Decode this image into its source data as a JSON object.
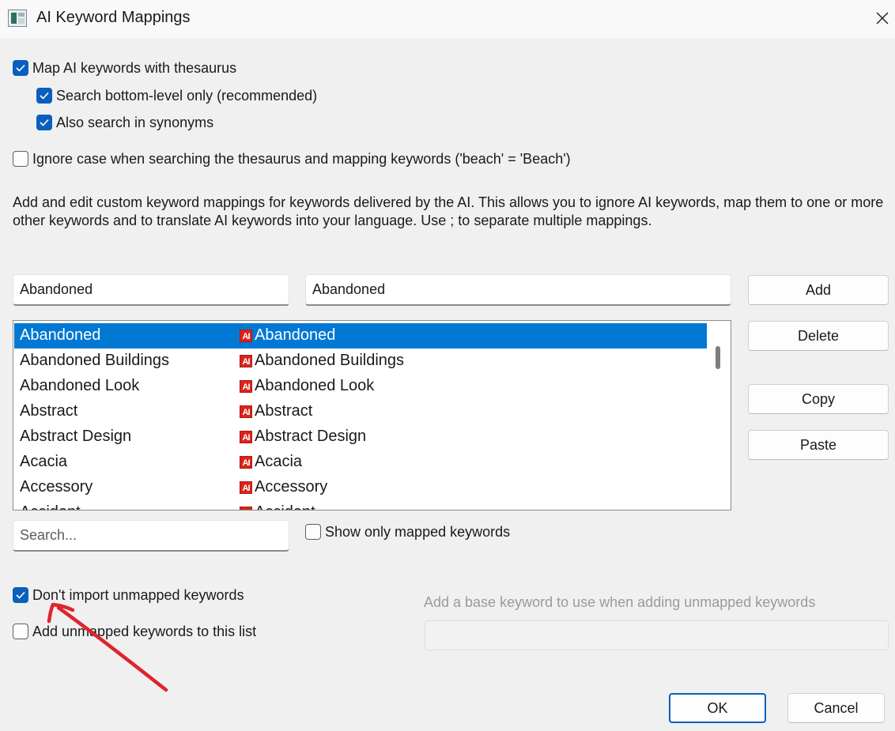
{
  "window": {
    "title": "AI Keyword Mappings",
    "icon": "app-icon",
    "close_icon": "close-icon"
  },
  "options": {
    "map_with_thesaurus": {
      "label": "Map AI keywords with thesaurus",
      "checked": true
    },
    "search_bottom_level": {
      "label": "Search bottom-level only (recommended)",
      "checked": true
    },
    "search_synonyms": {
      "label": "Also search in synonyms",
      "checked": true
    },
    "ignore_case": {
      "label": "Ignore case when searching the thesaurus and mapping keywords ('beach' = 'Beach')",
      "checked": false
    }
  },
  "description": "Add and edit custom keyword mappings for keywords delivered by the AI. This allows you to ignore AI keywords, map them to one or more other keywords and to translate AI keywords into your language. Use ; to separate multiple mappings.",
  "editor": {
    "ai_keyword_value": "Abandoned",
    "mapping_value": "Abandoned"
  },
  "buttons": {
    "add": "Add",
    "delete": "Delete",
    "copy": "Copy",
    "paste": "Paste",
    "ok": "OK",
    "cancel": "Cancel"
  },
  "mappings": [
    {
      "ai_keyword": "Abandoned",
      "mapped_to": "Abandoned",
      "selected": true
    },
    {
      "ai_keyword": "Abandoned Buildings",
      "mapped_to": "Abandoned Buildings",
      "selected": false
    },
    {
      "ai_keyword": "Abandoned Look",
      "mapped_to": "Abandoned Look",
      "selected": false
    },
    {
      "ai_keyword": "Abstract",
      "mapped_to": "Abstract",
      "selected": false
    },
    {
      "ai_keyword": "Abstract Design",
      "mapped_to": "Abstract Design",
      "selected": false
    },
    {
      "ai_keyword": "Acacia",
      "mapped_to": "Acacia",
      "selected": false
    },
    {
      "ai_keyword": "Accessory",
      "mapped_to": "Accessory",
      "selected": false
    },
    {
      "ai_keyword": "Accident",
      "mapped_to": "Accident",
      "selected": false
    }
  ],
  "ai_badge_text": "AI",
  "search": {
    "placeholder": "Search..."
  },
  "show_only_mapped": {
    "label": "Show only mapped keywords",
    "checked": false
  },
  "dont_import_unmapped": {
    "label": "Don't import unmapped keywords",
    "checked": true
  },
  "add_unmapped_to_list": {
    "label": "Add unmapped keywords to this list",
    "checked": false
  },
  "base_keyword": {
    "label": "Add a base keyword to use when adding unmapped keywords",
    "value": ""
  },
  "colors": {
    "accent": "#0078d4",
    "checkbox": "#0a5fbd",
    "annotation_arrow": "#e0242f"
  }
}
